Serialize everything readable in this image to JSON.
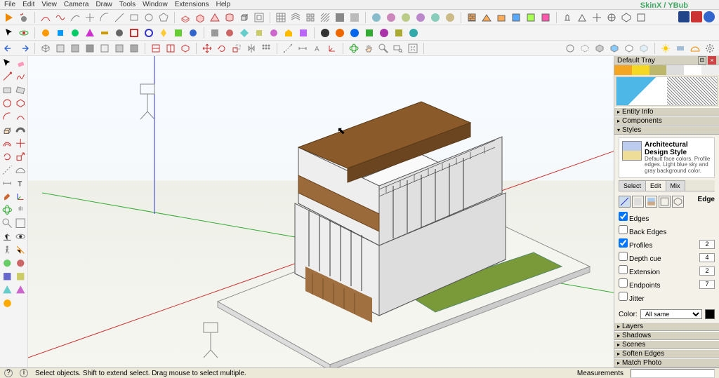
{
  "menu": [
    "File",
    "Edit",
    "View",
    "Camera",
    "Draw",
    "Tools",
    "Window",
    "Extensions",
    "Help"
  ],
  "skinx": "SkinX / YBub",
  "tray": {
    "title": "Default Tray",
    "panels": {
      "entity": "Entity Info",
      "components": "Components",
      "styles": "Styles",
      "layers": "Layers",
      "shadows": "Shadows",
      "scenes": "Scenes",
      "soften": "Soften Edges",
      "match": "Match Photo"
    },
    "style_name": "Architectural Design Style",
    "style_desc": "Default face colors. Profile edges. Light blue sky and gray background color.",
    "tabs": [
      "Select",
      "Edit",
      "Mix"
    ],
    "edge_header": "Edge",
    "edges": {
      "edges": {
        "label": "Edges",
        "checked": true,
        "val": ""
      },
      "back": {
        "label": "Back Edges",
        "checked": false,
        "val": ""
      },
      "profiles": {
        "label": "Profiles",
        "checked": true,
        "val": "2"
      },
      "depth": {
        "label": "Depth cue",
        "checked": false,
        "val": "4"
      },
      "extension": {
        "label": "Extension",
        "checked": false,
        "val": "2"
      },
      "endpoints": {
        "label": "Endpoints",
        "checked": false,
        "val": "7"
      },
      "jitter": {
        "label": "Jitter",
        "checked": false,
        "val": ""
      }
    },
    "color_label": "Color:",
    "color_mode": "All same"
  },
  "status": {
    "hint": "Select objects. Shift to extend select. Drag mouse to select multiple.",
    "measure_label": "Measurements"
  }
}
